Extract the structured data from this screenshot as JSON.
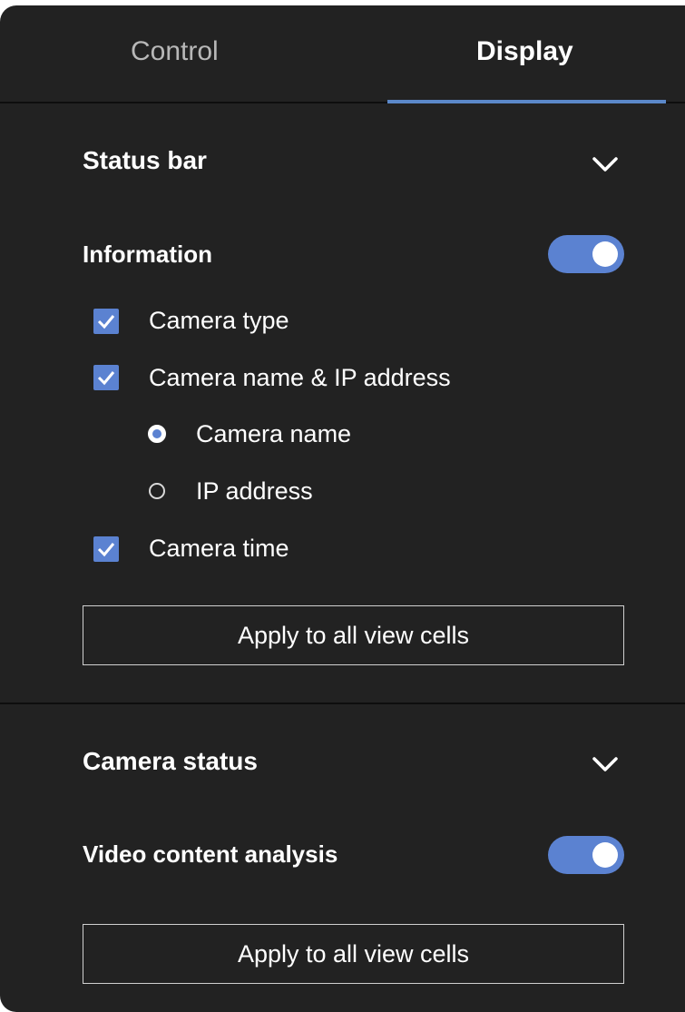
{
  "tabs": {
    "control": "Control",
    "display": "Display"
  },
  "status_bar": {
    "title": "Status bar",
    "information": {
      "label": "Information",
      "enabled": true
    },
    "options": {
      "camera_type": {
        "label": "Camera type",
        "checked": true
      },
      "camera_name_ip": {
        "label": "Camera name & IP address",
        "checked": true
      },
      "camera_name": {
        "label": "Camera name",
        "selected": true
      },
      "ip_address": {
        "label": "IP address",
        "selected": false
      },
      "camera_time": {
        "label": "Camera time",
        "checked": true
      }
    },
    "apply_label": "Apply to all view cells"
  },
  "camera_status": {
    "title": "Camera status",
    "video_content_analysis": {
      "label": "Video content analysis",
      "enabled": true
    },
    "apply_label": "Apply to all view cells"
  },
  "colors": {
    "panel_bg": "#222222",
    "accent": "#5b82d1",
    "tab_indicator": "#5b88c9"
  }
}
